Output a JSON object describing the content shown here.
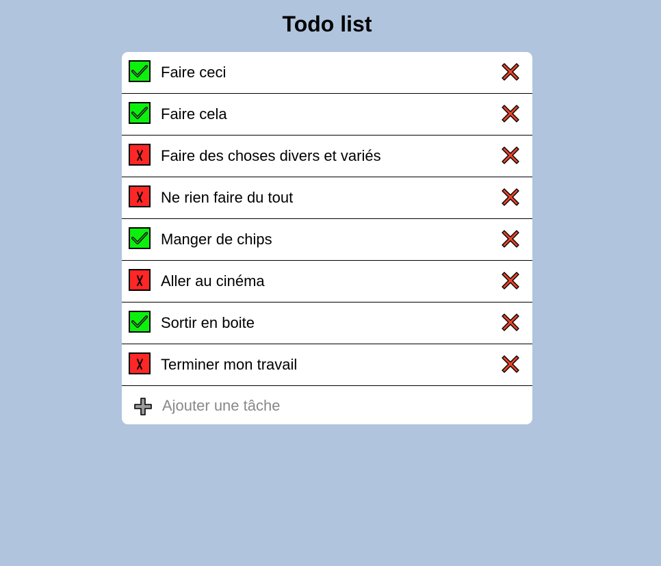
{
  "page": {
    "title": "Todo list"
  },
  "todos": [
    {
      "label": "Faire ceci",
      "done": true
    },
    {
      "label": "Faire cela",
      "done": true
    },
    {
      "label": "Faire des choses divers et variés",
      "done": false
    },
    {
      "label": "Ne rien faire du tout",
      "done": false
    },
    {
      "label": "Manger de chips",
      "done": true
    },
    {
      "label": "Aller au cinéma",
      "done": false
    },
    {
      "label": "Sortir en boite",
      "done": true
    },
    {
      "label": "Terminer mon travail",
      "done": false
    }
  ],
  "add": {
    "placeholder": "Ajouter une tâche",
    "value": ""
  },
  "icons": {
    "done": "check-icon",
    "todo": "cross-mark-icon",
    "delete": "delete-x-icon",
    "add": "plus-icon"
  },
  "colors": {
    "background": "#b0c4de",
    "done": "#0cf10c",
    "todo": "#ff2626",
    "delete": "#e8442a"
  }
}
